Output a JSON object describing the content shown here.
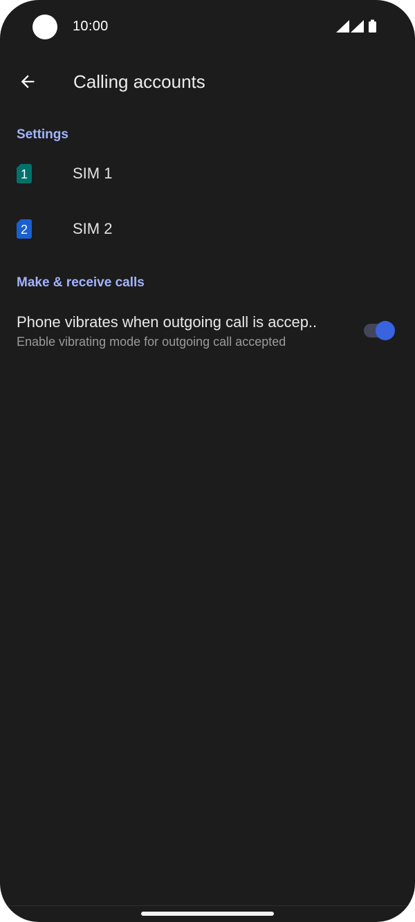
{
  "status_bar": {
    "time": "10:00",
    "icons": [
      "signal-icon",
      "signal-icon",
      "battery-icon"
    ]
  },
  "app_bar": {
    "title": "Calling accounts",
    "back_icon": "arrow-back-icon"
  },
  "sections": {
    "settings": {
      "header": "Settings",
      "items": [
        {
          "label": "SIM 1",
          "icon_text": "1",
          "icon_color": "#00726b"
        },
        {
          "label": "SIM 2",
          "icon_text": "2",
          "icon_color": "#1a5fd1"
        }
      ]
    },
    "calls": {
      "header": "Make & receive calls",
      "toggle": {
        "title": "Phone vibrates when outgoing call is accep..",
        "subtitle": "Enable vibrating mode for outgoing call accepted",
        "checked": true
      }
    }
  },
  "colors": {
    "background": "#1c1c1c",
    "accent": "#a3b4ff",
    "switch_on": "#3a63e0"
  }
}
